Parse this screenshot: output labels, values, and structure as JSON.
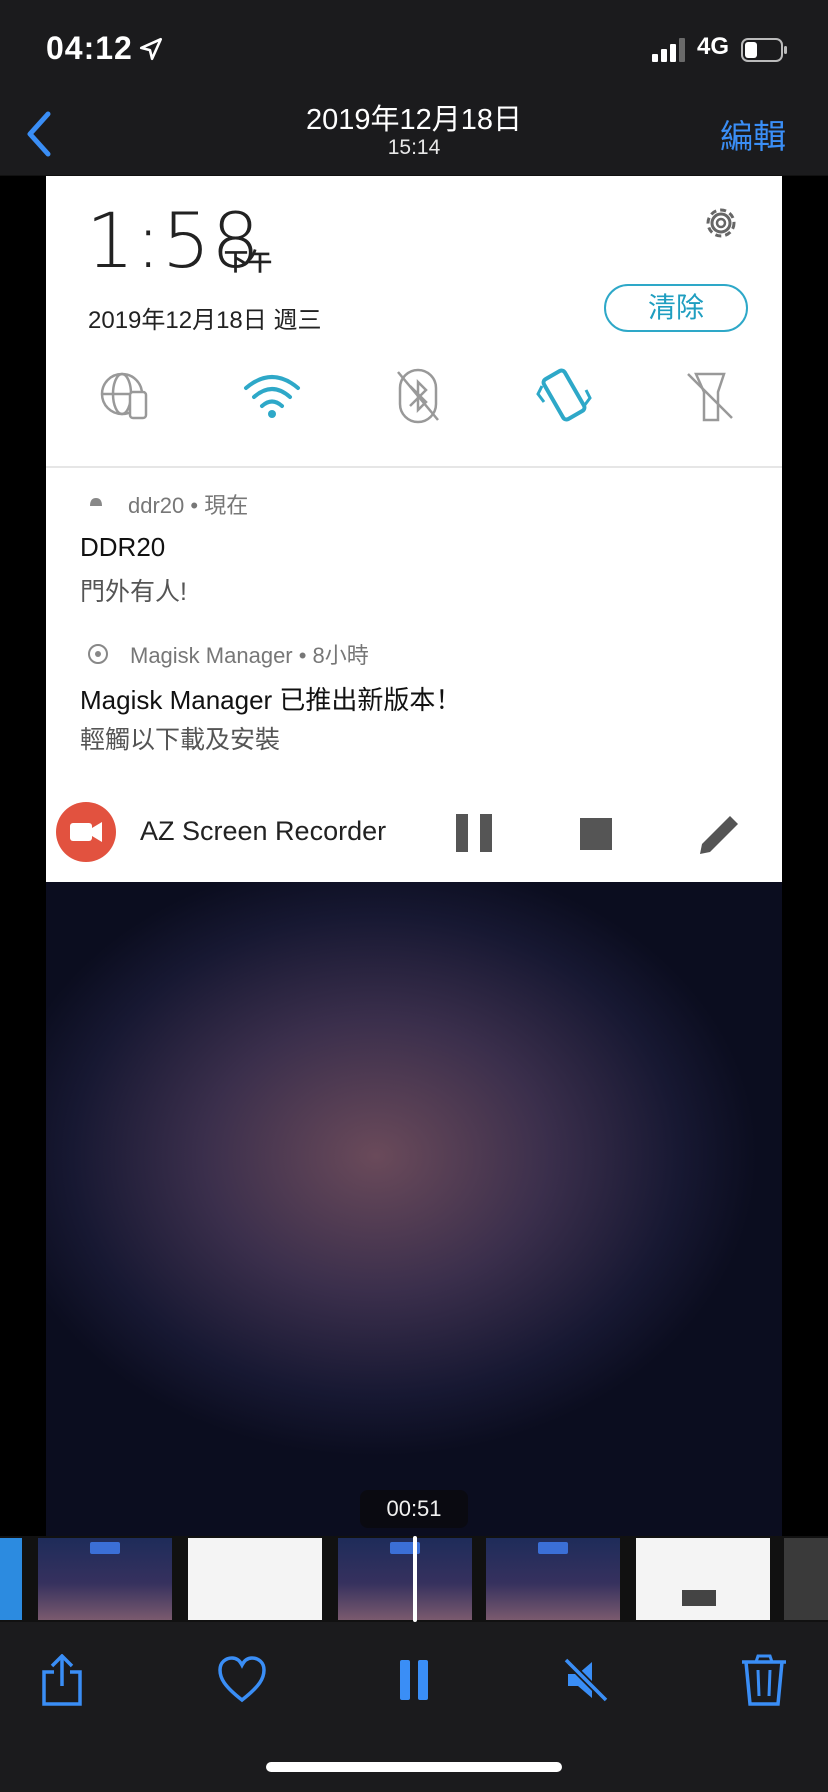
{
  "status_bar": {
    "time": "04:12",
    "network": "4G"
  },
  "nav": {
    "title": "2019年12月18日",
    "subtitle": "15:14",
    "edit": "編輯"
  },
  "video_frame": {
    "notification_shade": {
      "clock": "1:58",
      "ampm": "下午",
      "date": "2019年12月18日 週三",
      "clear_button": "清除",
      "quick_settings": [
        "network-icon",
        "wifi-icon",
        "bluetooth-off-icon",
        "vibrate-icon",
        "flashlight-off-icon"
      ],
      "notifications": [
        {
          "header": "ddr20 • 現在",
          "title": "DDR20",
          "body": "門外有人!"
        },
        {
          "header": "Magisk Manager • 8小時",
          "title": "Magisk Manager 已推出新版本！",
          "body": "輕觸以下載及安裝"
        }
      ],
      "recorder": {
        "label": "AZ Screen Recorder"
      }
    }
  },
  "timecode": "00:51",
  "toolbar": [
    "share-icon",
    "heart-icon",
    "pause-icon",
    "mute-icon",
    "trash-icon"
  ],
  "colors": {
    "accent": "#3a8ef6",
    "shade_accent": "#2ea8c8",
    "recorder_red": "#e2523f"
  }
}
